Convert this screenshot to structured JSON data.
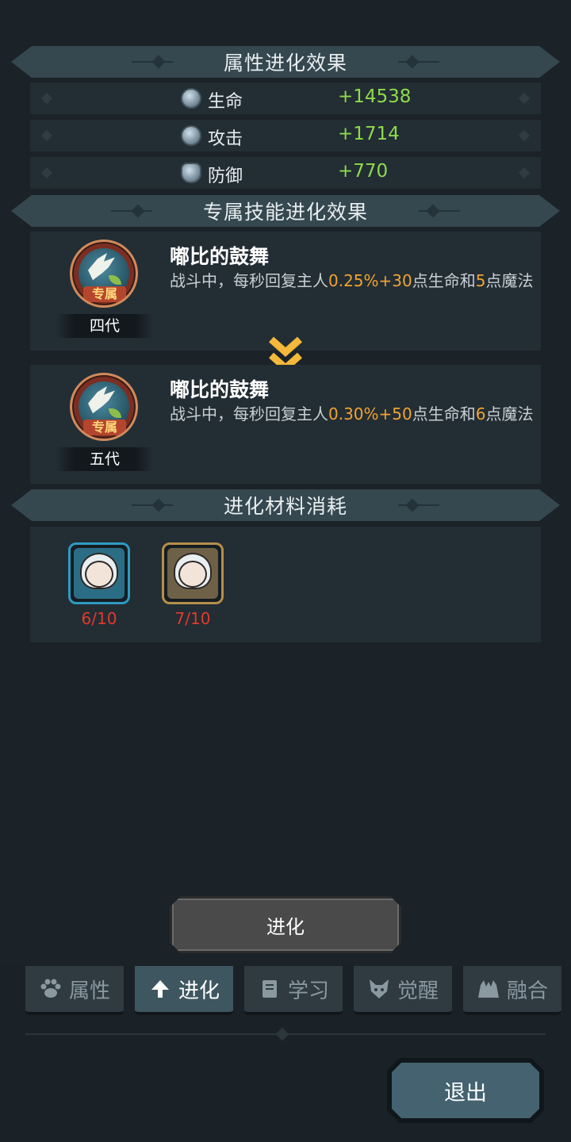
{
  "sections": {
    "attributes_title": "属性进化效果",
    "skill_title": "专属技能进化效果",
    "materials_title": "进化材料消耗"
  },
  "attributes": [
    {
      "name": "生命",
      "value": "+14538",
      "icon": "heart-icon"
    },
    {
      "name": "攻击",
      "value": "+1714",
      "icon": "attack-icon"
    },
    {
      "name": "防御",
      "value": "+770",
      "icon": "shield-icon"
    }
  ],
  "skills": [
    {
      "badge": "专属",
      "generation": "四代",
      "name": "嘟比的鼓舞",
      "desc_prefix": "战斗中，每秒回复主人",
      "pct": "0.25%",
      "flat": "+30",
      "desc_mid": "点生命和",
      "mana": "5",
      "desc_suffix": "点魔法"
    },
    {
      "badge": "专属",
      "generation": "五代",
      "name": "嘟比的鼓舞",
      "desc_prefix": "战斗中，每秒回复主人",
      "pct": "0.30%",
      "flat": "+50",
      "desc_mid": "点生命和",
      "mana": "6",
      "desc_suffix": "点魔法"
    }
  ],
  "materials": [
    {
      "count": "6/10",
      "frame": "blue"
    },
    {
      "count": "7/10",
      "frame": "gold"
    }
  ],
  "evolve_button": "进化",
  "tabs": [
    {
      "label": "属性",
      "icon": "paw-icon",
      "active": false
    },
    {
      "label": "进化",
      "icon": "arrow-up-icon",
      "active": true
    },
    {
      "label": "学习",
      "icon": "book-icon",
      "active": false
    },
    {
      "label": "觉醒",
      "icon": "wolf-icon",
      "active": false
    },
    {
      "label": "融合",
      "icon": "creatures-icon",
      "active": false
    }
  ],
  "exit_button": "退出",
  "colors": {
    "value_green": "#8ddc4a",
    "highlight_orange": "#f0a431",
    "count_red": "#e03a2e",
    "active_tab": "#3e5660"
  }
}
